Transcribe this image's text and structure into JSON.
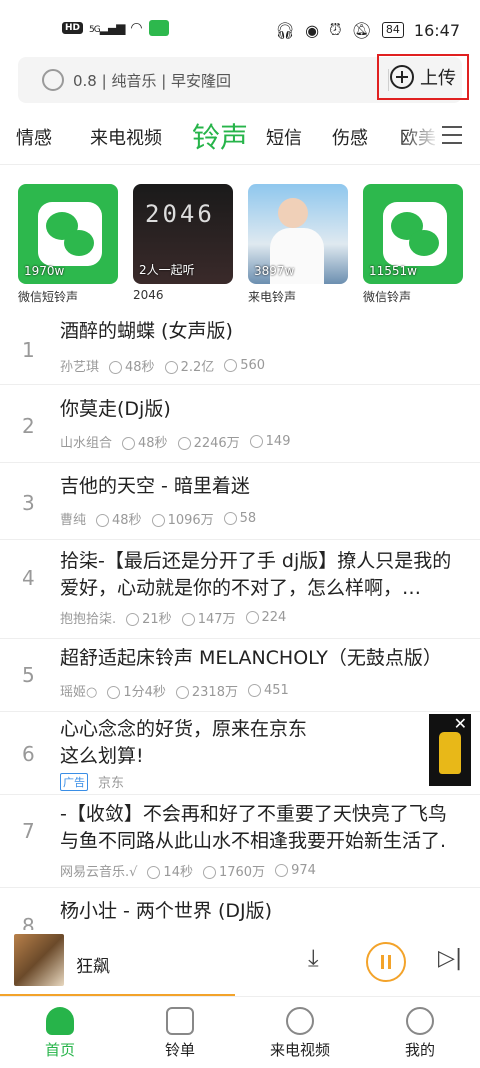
{
  "status_bar": {
    "time": "16:47",
    "battery": "84",
    "network": "5G",
    "hd": "HD"
  },
  "search": {
    "placeholder": "0.8 | 纯音乐 | 早安隆回",
    "upload_label": "上传"
  },
  "tabs": [
    {
      "label": "情感"
    },
    {
      "label": "来电视频"
    },
    {
      "label": "铃声",
      "active": true
    },
    {
      "label": "短信"
    },
    {
      "label": "伤感"
    },
    {
      "label": "欧美"
    }
  ],
  "cards": [
    {
      "caption": "微信短铃声",
      "overlay": "1970w"
    },
    {
      "caption": "2046",
      "overlay": "2人一起听",
      "image_text": "2046"
    },
    {
      "caption": "来电铃声",
      "overlay": "3897w"
    },
    {
      "caption": "微信铃声",
      "overlay": "11551w"
    }
  ],
  "songs": [
    {
      "num": "1",
      "title": "酒醉的蝴蝶 (女声版)",
      "artist": "孙艺琪",
      "duration": "48秒",
      "plays": "2.2亿",
      "comments": "560"
    },
    {
      "num": "2",
      "title": "你莫走(Dj版)",
      "artist": "山水组合",
      "duration": "48秒",
      "plays": "2246万",
      "comments": "149"
    },
    {
      "num": "3",
      "title": "吉他的天空 - 暗里着迷",
      "artist": "曹纯",
      "duration": "48秒",
      "plays": "1096万",
      "comments": "58"
    },
    {
      "num": "4",
      "title": "拾柒-【最后还是分开了手 dj版】撩人只是我的爱好，心动就是你的不对了，怎么样啊，…",
      "artist": "抱抱拾柒.",
      "duration": "21秒",
      "plays": "147万",
      "comments": "224"
    },
    {
      "num": "5",
      "title": "超舒适起床铃声 MELANCHOLY（无鼓点版）",
      "artist": "瑶姬○",
      "duration": "1分4秒",
      "plays": "2318万",
      "comments": "451"
    }
  ],
  "ad": {
    "num": "6",
    "title": "心心念念的好货，原来在京东这么划算!",
    "badge": "广告",
    "source": "京东"
  },
  "songs2": [
    {
      "num": "7",
      "title": "-【收敛】不会再和好了不重要了天快亮了飞鸟与鱼不同路从此山水不相逢我要开始新生活了.",
      "artist": "网易云音乐.√",
      "duration": "14秒",
      "plays": "1760万",
      "comments": "974"
    },
    {
      "num": "8",
      "title": "杨小壮 - 两个世界 (DJ版)"
    }
  ],
  "player": {
    "song": "狂飙",
    "progress": 0.49
  },
  "nav": [
    {
      "label": "首页",
      "active": true
    },
    {
      "label": "铃单"
    },
    {
      "label": "来电视频"
    },
    {
      "label": "我的"
    }
  ],
  "colors": {
    "accent": "#27b44a",
    "highlight": "#e02020",
    "player": "#f3a32a"
  }
}
